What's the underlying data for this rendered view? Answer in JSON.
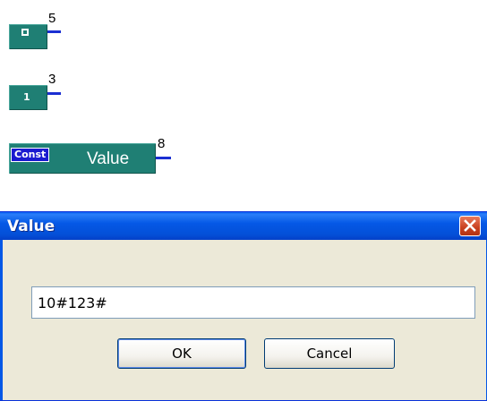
{
  "blocks": [
    {
      "id": "zero",
      "label": "0",
      "connector": "5"
    },
    {
      "id": "one",
      "label": "1",
      "connector": "3"
    },
    {
      "id": "const",
      "tag": "Const",
      "label": "Value",
      "connector": "8"
    }
  ],
  "dialog": {
    "title": "Value",
    "input_value": "10#123#",
    "ok_label": "OK",
    "cancel_label": "Cancel"
  },
  "colors": {
    "block_teal": "#1f7f74",
    "connector_blue": "#1b2fd2",
    "titlebar_blue": "#0558e6",
    "close_red": "#c8401f"
  },
  "icons": {
    "close": "close-x-icon"
  }
}
